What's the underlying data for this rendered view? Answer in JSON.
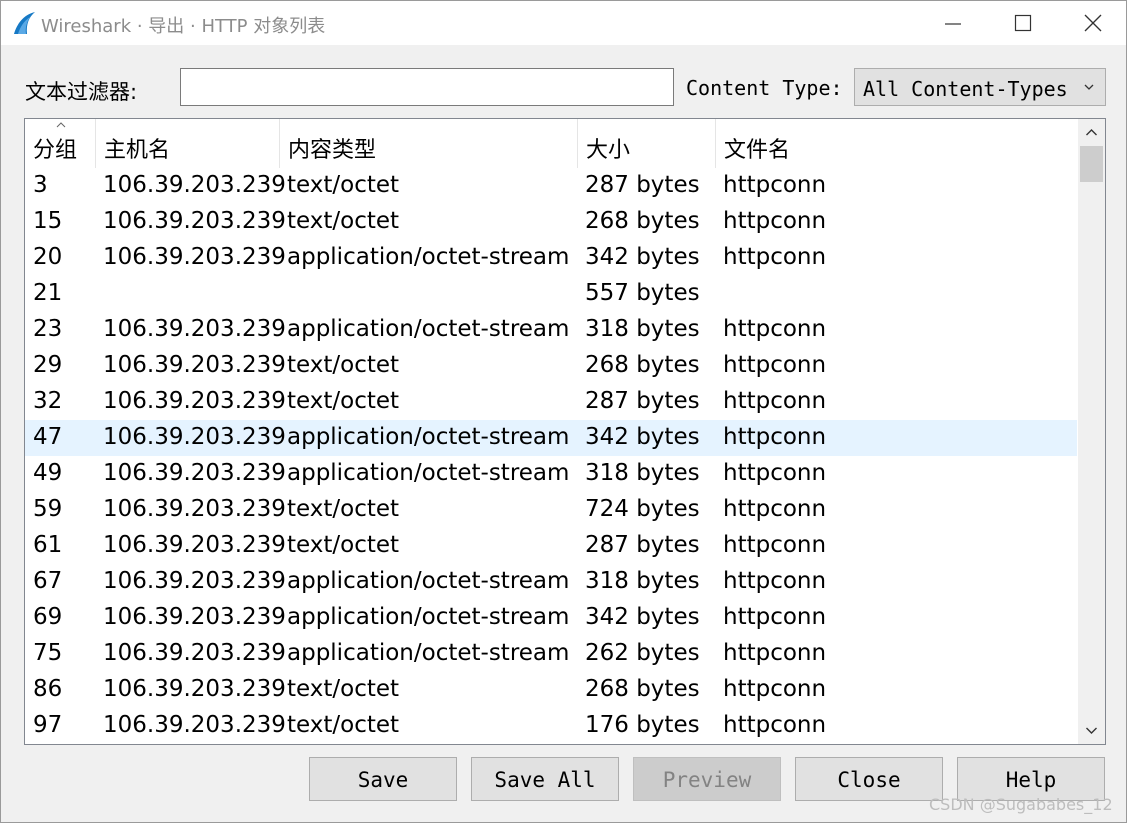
{
  "window": {
    "title": "Wireshark · 导出 · HTTP 对象列表",
    "icon": "wireshark-fin-icon"
  },
  "filter": {
    "label": "文本过滤器:",
    "value": "",
    "content_type_label": "Content Type:",
    "content_type_value": "All Content-Types"
  },
  "table": {
    "columns": [
      "分组",
      "主机名",
      "内容类型",
      "大小",
      "文件名"
    ],
    "rows": [
      {
        "num": "3",
        "host": "106.39.203.239",
        "type": "text/octet",
        "size": "287 bytes",
        "file": "httpconn"
      },
      {
        "num": "15",
        "host": "106.39.203.239",
        "type": "text/octet",
        "size": "268 bytes",
        "file": "httpconn"
      },
      {
        "num": "20",
        "host": "106.39.203.239",
        "type": "application/octet-stream",
        "size": "342 bytes",
        "file": "httpconn"
      },
      {
        "num": "21",
        "host": "",
        "type": "",
        "size": "557 bytes",
        "file": ""
      },
      {
        "num": "23",
        "host": "106.39.203.239",
        "type": "application/octet-stream",
        "size": "318 bytes",
        "file": "httpconn"
      },
      {
        "num": "29",
        "host": "106.39.203.239",
        "type": "text/octet",
        "size": "268 bytes",
        "file": "httpconn"
      },
      {
        "num": "32",
        "host": "106.39.203.239",
        "type": "text/octet",
        "size": "287 bytes",
        "file": "httpconn"
      },
      {
        "num": "47",
        "host": "106.39.203.239",
        "type": "application/octet-stream",
        "size": "342 bytes",
        "file": "httpconn"
      },
      {
        "num": "49",
        "host": "106.39.203.239",
        "type": "application/octet-stream",
        "size": "318 bytes",
        "file": "httpconn"
      },
      {
        "num": "59",
        "host": "106.39.203.239",
        "type": "text/octet",
        "size": "724 bytes",
        "file": "httpconn"
      },
      {
        "num": "61",
        "host": "106.39.203.239",
        "type": "text/octet",
        "size": "287 bytes",
        "file": "httpconn"
      },
      {
        "num": "67",
        "host": "106.39.203.239",
        "type": "application/octet-stream",
        "size": "318 bytes",
        "file": "httpconn"
      },
      {
        "num": "69",
        "host": "106.39.203.239",
        "type": "application/octet-stream",
        "size": "342 bytes",
        "file": "httpconn"
      },
      {
        "num": "75",
        "host": "106.39.203.239",
        "type": "application/octet-stream",
        "size": "262 bytes",
        "file": "httpconn"
      },
      {
        "num": "86",
        "host": "106.39.203.239",
        "type": "text/octet",
        "size": "268 bytes",
        "file": "httpconn"
      },
      {
        "num": "97",
        "host": "106.39.203.239",
        "type": "text/octet",
        "size": "176 bytes",
        "file": "httpconn"
      }
    ],
    "selected_row_index": 7
  },
  "buttons": {
    "save": "Save",
    "save_all": "Save All",
    "preview": "Preview",
    "close": "Close",
    "help": "Help"
  },
  "watermark": "CSDN @Sugababes_12",
  "colors": {
    "selected_row": "#e5f3ff",
    "disabled_text": "#838383"
  }
}
